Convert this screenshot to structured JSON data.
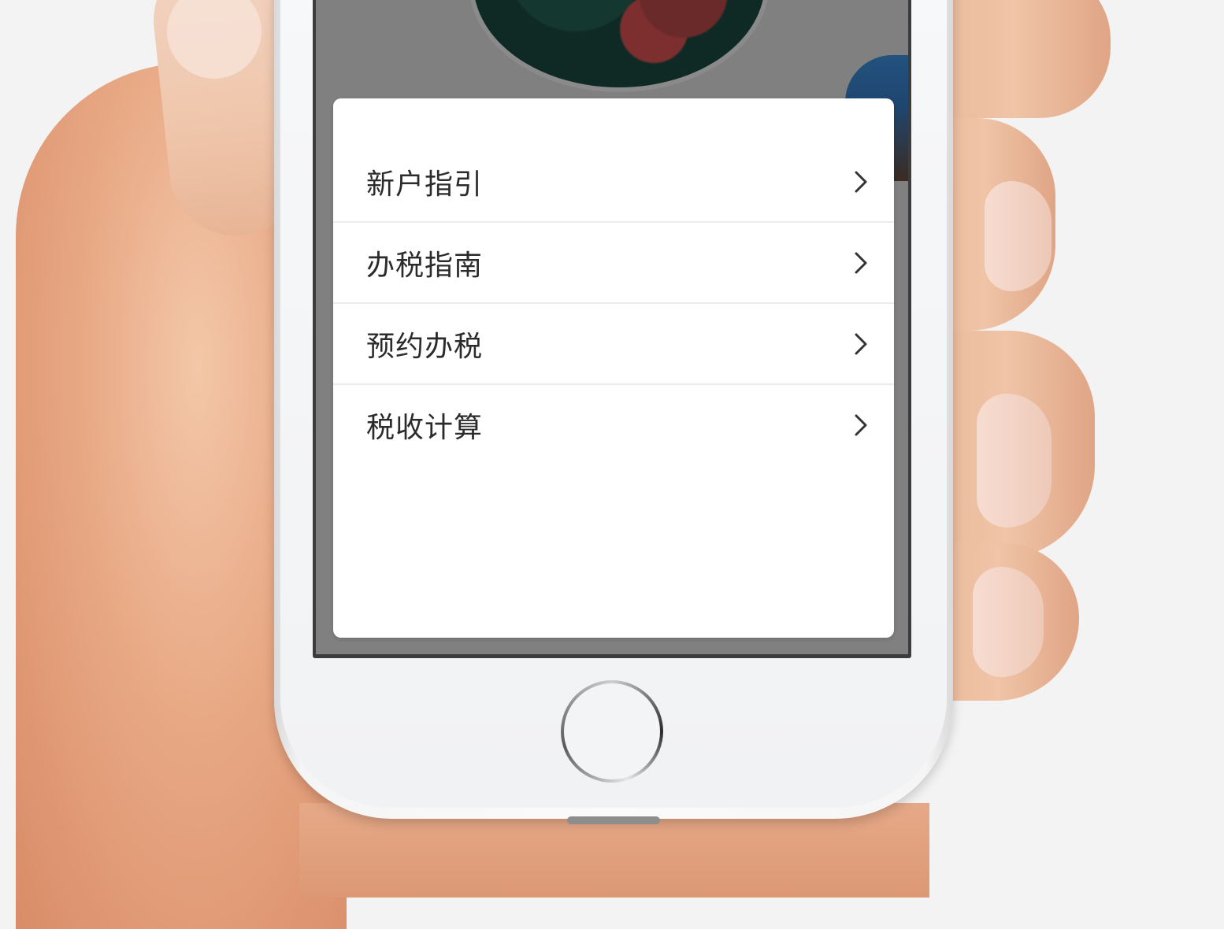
{
  "menu": {
    "items": [
      {
        "label": "新户指引"
      },
      {
        "label": "办税指南"
      },
      {
        "label": "预约办税"
      },
      {
        "label": "税收计算"
      }
    ]
  },
  "icons": {
    "chevron": "chevron-right-icon"
  },
  "colors": {
    "overlay": "#808080",
    "panel": "#ffffff",
    "text": "#2b2b2b",
    "divider": "#ececec",
    "chevron": "#333333"
  }
}
